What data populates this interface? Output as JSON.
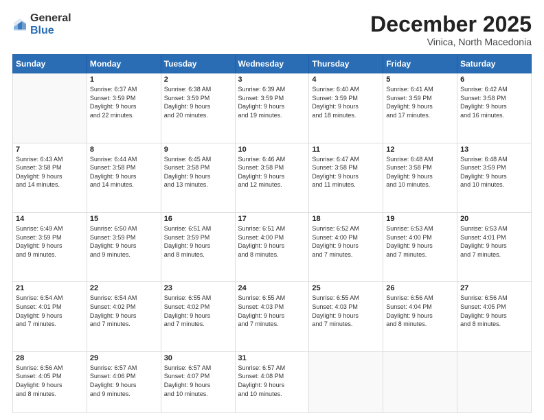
{
  "logo": {
    "general": "General",
    "blue": "Blue"
  },
  "header": {
    "month": "December 2025",
    "location": "Vinica, North Macedonia"
  },
  "weekdays": [
    "Sunday",
    "Monday",
    "Tuesday",
    "Wednesday",
    "Thursday",
    "Friday",
    "Saturday"
  ],
  "weeks": [
    [
      {
        "day": "",
        "info": ""
      },
      {
        "day": "1",
        "info": "Sunrise: 6:37 AM\nSunset: 3:59 PM\nDaylight: 9 hours\nand 22 minutes."
      },
      {
        "day": "2",
        "info": "Sunrise: 6:38 AM\nSunset: 3:59 PM\nDaylight: 9 hours\nand 20 minutes."
      },
      {
        "day": "3",
        "info": "Sunrise: 6:39 AM\nSunset: 3:59 PM\nDaylight: 9 hours\nand 19 minutes."
      },
      {
        "day": "4",
        "info": "Sunrise: 6:40 AM\nSunset: 3:59 PM\nDaylight: 9 hours\nand 18 minutes."
      },
      {
        "day": "5",
        "info": "Sunrise: 6:41 AM\nSunset: 3:59 PM\nDaylight: 9 hours\nand 17 minutes."
      },
      {
        "day": "6",
        "info": "Sunrise: 6:42 AM\nSunset: 3:58 PM\nDaylight: 9 hours\nand 16 minutes."
      }
    ],
    [
      {
        "day": "7",
        "info": "Sunrise: 6:43 AM\nSunset: 3:58 PM\nDaylight: 9 hours\nand 14 minutes."
      },
      {
        "day": "8",
        "info": "Sunrise: 6:44 AM\nSunset: 3:58 PM\nDaylight: 9 hours\nand 14 minutes."
      },
      {
        "day": "9",
        "info": "Sunrise: 6:45 AM\nSunset: 3:58 PM\nDaylight: 9 hours\nand 13 minutes."
      },
      {
        "day": "10",
        "info": "Sunrise: 6:46 AM\nSunset: 3:58 PM\nDaylight: 9 hours\nand 12 minutes."
      },
      {
        "day": "11",
        "info": "Sunrise: 6:47 AM\nSunset: 3:58 PM\nDaylight: 9 hours\nand 11 minutes."
      },
      {
        "day": "12",
        "info": "Sunrise: 6:48 AM\nSunset: 3:58 PM\nDaylight: 9 hours\nand 10 minutes."
      },
      {
        "day": "13",
        "info": "Sunrise: 6:48 AM\nSunset: 3:59 PM\nDaylight: 9 hours\nand 10 minutes."
      }
    ],
    [
      {
        "day": "14",
        "info": "Sunrise: 6:49 AM\nSunset: 3:59 PM\nDaylight: 9 hours\nand 9 minutes."
      },
      {
        "day": "15",
        "info": "Sunrise: 6:50 AM\nSunset: 3:59 PM\nDaylight: 9 hours\nand 9 minutes."
      },
      {
        "day": "16",
        "info": "Sunrise: 6:51 AM\nSunset: 3:59 PM\nDaylight: 9 hours\nand 8 minutes."
      },
      {
        "day": "17",
        "info": "Sunrise: 6:51 AM\nSunset: 4:00 PM\nDaylight: 9 hours\nand 8 minutes."
      },
      {
        "day": "18",
        "info": "Sunrise: 6:52 AM\nSunset: 4:00 PM\nDaylight: 9 hours\nand 7 minutes."
      },
      {
        "day": "19",
        "info": "Sunrise: 6:53 AM\nSunset: 4:00 PM\nDaylight: 9 hours\nand 7 minutes."
      },
      {
        "day": "20",
        "info": "Sunrise: 6:53 AM\nSunset: 4:01 PM\nDaylight: 9 hours\nand 7 minutes."
      }
    ],
    [
      {
        "day": "21",
        "info": "Sunrise: 6:54 AM\nSunset: 4:01 PM\nDaylight: 9 hours\nand 7 minutes."
      },
      {
        "day": "22",
        "info": "Sunrise: 6:54 AM\nSunset: 4:02 PM\nDaylight: 9 hours\nand 7 minutes."
      },
      {
        "day": "23",
        "info": "Sunrise: 6:55 AM\nSunset: 4:02 PM\nDaylight: 9 hours\nand 7 minutes."
      },
      {
        "day": "24",
        "info": "Sunrise: 6:55 AM\nSunset: 4:03 PM\nDaylight: 9 hours\nand 7 minutes."
      },
      {
        "day": "25",
        "info": "Sunrise: 6:55 AM\nSunset: 4:03 PM\nDaylight: 9 hours\nand 7 minutes."
      },
      {
        "day": "26",
        "info": "Sunrise: 6:56 AM\nSunset: 4:04 PM\nDaylight: 9 hours\nand 8 minutes."
      },
      {
        "day": "27",
        "info": "Sunrise: 6:56 AM\nSunset: 4:05 PM\nDaylight: 9 hours\nand 8 minutes."
      }
    ],
    [
      {
        "day": "28",
        "info": "Sunrise: 6:56 AM\nSunset: 4:05 PM\nDaylight: 9 hours\nand 8 minutes."
      },
      {
        "day": "29",
        "info": "Sunrise: 6:57 AM\nSunset: 4:06 PM\nDaylight: 9 hours\nand 9 minutes."
      },
      {
        "day": "30",
        "info": "Sunrise: 6:57 AM\nSunset: 4:07 PM\nDaylight: 9 hours\nand 10 minutes."
      },
      {
        "day": "31",
        "info": "Sunrise: 6:57 AM\nSunset: 4:08 PM\nDaylight: 9 hours\nand 10 minutes."
      },
      {
        "day": "",
        "info": ""
      },
      {
        "day": "",
        "info": ""
      },
      {
        "day": "",
        "info": ""
      }
    ]
  ]
}
